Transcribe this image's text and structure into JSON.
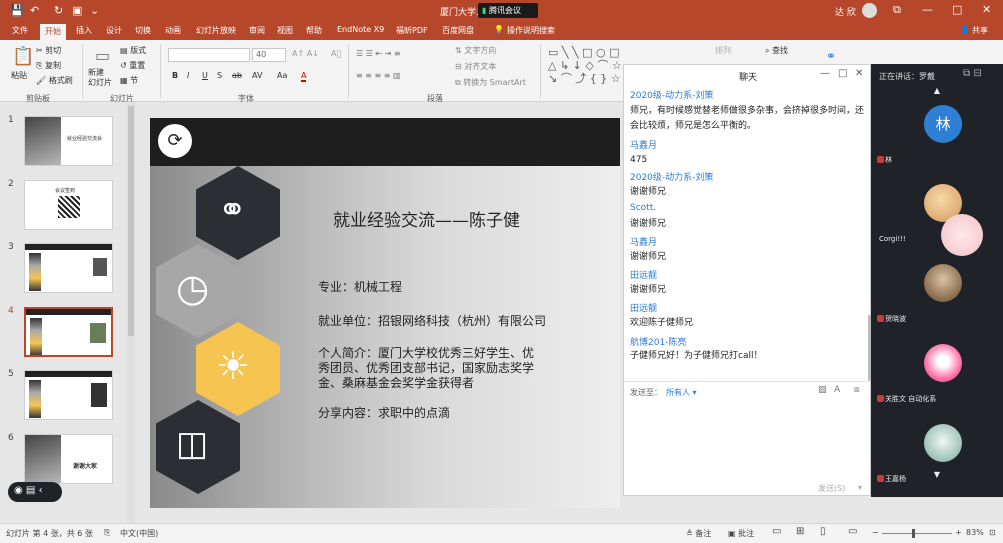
{
  "titlebar": {
    "doc_title": "厦门大学...erPoint",
    "meeting_label": "腾讯会议",
    "user_name": "达 欣",
    "controls": [
      "—",
      "□",
      "✕"
    ]
  },
  "tabs": [
    "文件",
    "开始",
    "插入",
    "设计",
    "切换",
    "动画",
    "幻灯片放映",
    "审阅",
    "视图",
    "帮助",
    "EndNote X9",
    "福昕PDF",
    "百度网盘",
    "操作说明搜索"
  ],
  "share_label": "共享",
  "ribbon": {
    "paste": "粘贴",
    "cut": "剪切",
    "copy": "复制",
    "format_painter": "格式刷",
    "new_slide": "新建\n幻灯片",
    "layout": "版式",
    "reset": "重置",
    "section": "节",
    "font_size": "40",
    "text_direction": "文字方向",
    "align_text": "对齐文本",
    "smartart": "转换为 SmartArt",
    "arrange": "排列",
    "find": "查找",
    "groups": [
      "剪贴板",
      "幻灯片",
      "字体",
      "段落"
    ],
    "format_buttons": [
      "B",
      "I",
      "U",
      "S",
      "ab",
      "AV",
      "Aa",
      "A"
    ]
  },
  "slides": [
    {
      "num": "1",
      "title": "就业经验交流会"
    },
    {
      "num": "2",
      "title": "会议签到"
    },
    {
      "num": "3",
      "title": ""
    },
    {
      "num": "4",
      "title": ""
    },
    {
      "num": "5",
      "title": ""
    },
    {
      "num": "6",
      "title": "谢谢大家"
    }
  ],
  "current_slide": {
    "title": "就业经验交流——陈子健",
    "lines": [
      "专业：机械工程",
      "就业单位：招银网络科技（杭州）有限公司",
      "个人简介：厦门大学校优秀三好学生、优",
      "秀团员、优秀团支部书记，国家励志奖学",
      "金、桑麻基金会奖学金获得者",
      "分享内容：求职中的点滴"
    ]
  },
  "chat": {
    "title": "聊天",
    "messages": [
      {
        "name": "2020级-动力系-刘策",
        "text": "师兄，有时候感觉替老师做很多杂事，会挤掉很多时间，还会比较烦，师兄是怎么平衡的。"
      },
      {
        "name": "马鑫月",
        "text": "475"
      },
      {
        "name": "2020级-动力系-刘策",
        "text": "谢谢师兄"
      },
      {
        "name": "Scott.",
        "text": "谢谢师兄"
      },
      {
        "name": "马鑫月",
        "text": "谢谢师兄"
      },
      {
        "name": "田远靓",
        "text": "谢谢师兄"
      },
      {
        "name": "田远靓",
        "text": "欢迎陈子健师兄"
      },
      {
        "name": "航博201-陈亮",
        "text": "子健师兄好！为子健师兄打call！"
      }
    ],
    "send_to_label": "发送至：",
    "send_to_value": "所有人 ▾",
    "send_button": "发送(S)"
  },
  "meeting": {
    "speaking": "正在讲话：罗戴",
    "participants": [
      {
        "name": "林",
        "initial": "林"
      },
      {
        "name": "Corgi!!!",
        "initial": ""
      },
      {
        "name": "贺晓波",
        "initial": ""
      },
      {
        "name": "关胜文 自动化系",
        "initial": ""
      },
      {
        "name": "王嘉杨",
        "initial": ""
      }
    ]
  },
  "statusbar": {
    "slide_info": "幻灯片 第 4 张，共 6 张",
    "language": "中文(中国)",
    "notes": "备注",
    "comments": "批注",
    "zoom": "83%"
  },
  "colors": {
    "accent": "#b7472a",
    "link": "#2a7ad5",
    "hex_dark": "#2b2f33",
    "hex_gray": "#a7a7a7",
    "hex_yellow": "#f5c451"
  }
}
